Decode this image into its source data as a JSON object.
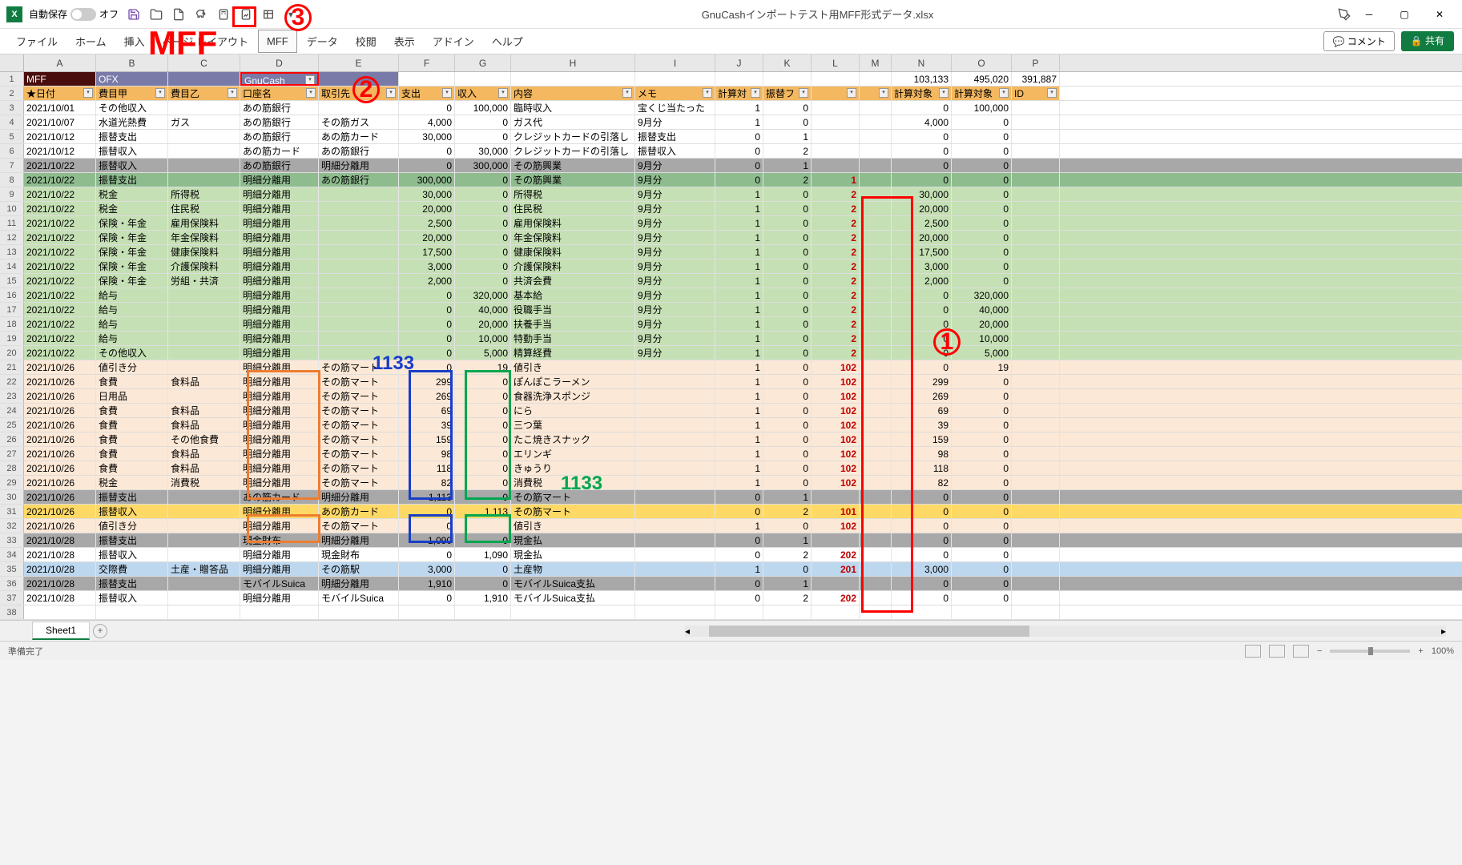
{
  "title": "GnuCashインポートテスト用MFF形式データ.xlsx",
  "autosave_label": "自動保存",
  "autosave_state": "オフ",
  "ribbon": [
    "ファイル",
    "ホーム",
    "挿入",
    "ページ レイアウト",
    "MFF",
    "データ",
    "校閲",
    "表示",
    "アドイン",
    "ヘルプ"
  ],
  "ribbon_active": "MFF",
  "comment_btn": "コメント",
  "share_btn": "共有",
  "cols": [
    "A",
    "B",
    "C",
    "D",
    "E",
    "F",
    "G",
    "H",
    "I",
    "J",
    "K",
    "L",
    "M",
    "N",
    "O",
    "P"
  ],
  "widths": [
    90,
    90,
    90,
    98,
    100,
    70,
    70,
    155,
    100,
    60,
    60,
    60,
    40,
    75,
    75,
    60
  ],
  "row1": {
    "A": "MFF",
    "B": "OFX",
    "D": "GnuCash",
    "N": "103,133",
    "O": "495,020",
    "P": "391,887"
  },
  "headers": [
    "★日付",
    "費目甲",
    "費目乙",
    "口座名",
    "取引先",
    "支出",
    "収入",
    "内容",
    "メモ",
    "計算対",
    "振替フ",
    "",
    "",
    "計算対象",
    "計算対象",
    "ID"
  ],
  "rows": [
    {
      "n": 3,
      "bg": "",
      "d": [
        "2021/10/01",
        "その他収入",
        "",
        "あの筋銀行",
        "",
        "0",
        "100,000",
        "臨時収入",
        "宝くじ当たった",
        "1",
        "0",
        "",
        "",
        "0",
        "100,000",
        ""
      ]
    },
    {
      "n": 4,
      "bg": "",
      "d": [
        "2021/10/07",
        "水道光熱費",
        "ガス",
        "あの筋銀行",
        "その筋ガス",
        "4,000",
        "0",
        "ガス代",
        "9月分",
        "1",
        "0",
        "",
        "",
        "4,000",
        "0",
        ""
      ]
    },
    {
      "n": 5,
      "bg": "",
      "d": [
        "2021/10/12",
        "振替支出",
        "",
        "あの筋銀行",
        "あの筋カード",
        "30,000",
        "0",
        "クレジットカードの引落し",
        "振替支出",
        "0",
        "1",
        "",
        "",
        "0",
        "0",
        ""
      ]
    },
    {
      "n": 6,
      "bg": "",
      "d": [
        "2021/10/12",
        "振替収入",
        "",
        "あの筋カード",
        "あの筋銀行",
        "0",
        "30,000",
        "クレジットカードの引落し",
        "振替収入",
        "0",
        "2",
        "",
        "",
        "0",
        "0",
        ""
      ]
    },
    {
      "n": 7,
      "bg": "bg-gray",
      "d": [
        "2021/10/22",
        "振替収入",
        "",
        "あの筋銀行",
        "明細分離用",
        "0",
        "300,000",
        "その筋興業",
        "9月分",
        "0",
        "1",
        "",
        "",
        "0",
        "0",
        ""
      ]
    },
    {
      "n": 8,
      "bg": "bg-dgreen",
      "d": [
        "2021/10/22",
        "振替支出",
        "",
        "明細分離用",
        "あの筋銀行",
        "300,000",
        "0",
        "その筋興業",
        "9月分",
        "0",
        "2",
        "1",
        "",
        "0",
        "0",
        ""
      ],
      "red": [
        11
      ]
    },
    {
      "n": 9,
      "bg": "bg-green",
      "d": [
        "2021/10/22",
        "税金",
        "所得税",
        "明細分離用",
        "",
        "30,000",
        "0",
        "所得税",
        "9月分",
        "1",
        "0",
        "2",
        "",
        "30,000",
        "0",
        ""
      ],
      "red": [
        11
      ]
    },
    {
      "n": 10,
      "bg": "bg-green",
      "d": [
        "2021/10/22",
        "税金",
        "住民税",
        "明細分離用",
        "",
        "20,000",
        "0",
        "住民税",
        "9月分",
        "1",
        "0",
        "2",
        "",
        "20,000",
        "0",
        ""
      ],
      "red": [
        11
      ]
    },
    {
      "n": 11,
      "bg": "bg-green",
      "d": [
        "2021/10/22",
        "保険・年金",
        "雇用保険料",
        "明細分離用",
        "",
        "2,500",
        "0",
        "雇用保険料",
        "9月分",
        "1",
        "0",
        "2",
        "",
        "2,500",
        "0",
        ""
      ],
      "red": [
        11
      ]
    },
    {
      "n": 12,
      "bg": "bg-green",
      "d": [
        "2021/10/22",
        "保険・年金",
        "年金保険料",
        "明細分離用",
        "",
        "20,000",
        "0",
        "年金保険料",
        "9月分",
        "1",
        "0",
        "2",
        "",
        "20,000",
        "0",
        ""
      ],
      "red": [
        11
      ]
    },
    {
      "n": 13,
      "bg": "bg-green",
      "d": [
        "2021/10/22",
        "保険・年金",
        "健康保険料",
        "明細分離用",
        "",
        "17,500",
        "0",
        "健康保険料",
        "9月分",
        "1",
        "0",
        "2",
        "",
        "17,500",
        "0",
        ""
      ],
      "red": [
        11
      ]
    },
    {
      "n": 14,
      "bg": "bg-green",
      "d": [
        "2021/10/22",
        "保険・年金",
        "介護保険料",
        "明細分離用",
        "",
        "3,000",
        "0",
        "介護保険料",
        "9月分",
        "1",
        "0",
        "2",
        "",
        "3,000",
        "0",
        ""
      ],
      "red": [
        11
      ]
    },
    {
      "n": 15,
      "bg": "bg-green",
      "d": [
        "2021/10/22",
        "保険・年金",
        "労組・共済",
        "明細分離用",
        "",
        "2,000",
        "0",
        "共済会費",
        "9月分",
        "1",
        "0",
        "2",
        "",
        "2,000",
        "0",
        ""
      ],
      "red": [
        11
      ]
    },
    {
      "n": 16,
      "bg": "bg-green",
      "d": [
        "2021/10/22",
        "給与",
        "",
        "明細分離用",
        "",
        "0",
        "320,000",
        "基本給",
        "9月分",
        "1",
        "0",
        "2",
        "",
        "0",
        "320,000",
        ""
      ],
      "red": [
        11
      ]
    },
    {
      "n": 17,
      "bg": "bg-green",
      "d": [
        "2021/10/22",
        "給与",
        "",
        "明細分離用",
        "",
        "0",
        "40,000",
        "役職手当",
        "9月分",
        "1",
        "0",
        "2",
        "",
        "0",
        "40,000",
        ""
      ],
      "red": [
        11
      ]
    },
    {
      "n": 18,
      "bg": "bg-green",
      "d": [
        "2021/10/22",
        "給与",
        "",
        "明細分離用",
        "",
        "0",
        "20,000",
        "扶養手当",
        "9月分",
        "1",
        "0",
        "2",
        "",
        "0",
        "20,000",
        ""
      ],
      "red": [
        11
      ]
    },
    {
      "n": 19,
      "bg": "bg-green",
      "d": [
        "2021/10/22",
        "給与",
        "",
        "明細分離用",
        "",
        "0",
        "10,000",
        "特勤手当",
        "9月分",
        "1",
        "0",
        "2",
        "",
        "0",
        "10,000",
        ""
      ],
      "red": [
        11
      ]
    },
    {
      "n": 20,
      "bg": "bg-green",
      "d": [
        "2021/10/22",
        "その他収入",
        "",
        "明細分離用",
        "",
        "0",
        "5,000",
        "精算経費",
        "9月分",
        "1",
        "0",
        "2",
        "",
        "0",
        "5,000",
        ""
      ],
      "red": [
        11
      ]
    },
    {
      "n": 21,
      "bg": "bg-cream",
      "d": [
        "2021/10/26",
        "値引き分",
        "",
        "明細分離用",
        "その筋マート",
        "0",
        "19",
        "値引き",
        "",
        "1",
        "0",
        "102",
        "",
        "0",
        "19",
        ""
      ],
      "red": [
        11
      ]
    },
    {
      "n": 22,
      "bg": "bg-cream",
      "d": [
        "2021/10/26",
        "食費",
        "食料品",
        "明細分離用",
        "その筋マート",
        "299",
        "0",
        "ぽんぽこラーメン",
        "",
        "1",
        "0",
        "102",
        "",
        "299",
        "0",
        ""
      ],
      "red": [
        11
      ]
    },
    {
      "n": 23,
      "bg": "bg-cream",
      "d": [
        "2021/10/26",
        "日用品",
        "",
        "明細分離用",
        "その筋マート",
        "269",
        "0",
        "食器洗浄スポンジ",
        "",
        "1",
        "0",
        "102",
        "",
        "269",
        "0",
        ""
      ],
      "red": [
        11
      ]
    },
    {
      "n": 24,
      "bg": "bg-cream",
      "d": [
        "2021/10/26",
        "食費",
        "食料品",
        "明細分離用",
        "その筋マート",
        "69",
        "0",
        "にら",
        "",
        "1",
        "0",
        "102",
        "",
        "69",
        "0",
        ""
      ],
      "red": [
        11
      ]
    },
    {
      "n": 25,
      "bg": "bg-cream",
      "d": [
        "2021/10/26",
        "食費",
        "食料品",
        "明細分離用",
        "その筋マート",
        "39",
        "0",
        "三つ葉",
        "",
        "1",
        "0",
        "102",
        "",
        "39",
        "0",
        ""
      ],
      "red": [
        11
      ]
    },
    {
      "n": 26,
      "bg": "bg-cream",
      "d": [
        "2021/10/26",
        "食費",
        "その他食費",
        "明細分離用",
        "その筋マート",
        "159",
        "0",
        "たこ焼きスナック",
        "",
        "1",
        "0",
        "102",
        "",
        "159",
        "0",
        ""
      ],
      "red": [
        11
      ]
    },
    {
      "n": 27,
      "bg": "bg-cream",
      "d": [
        "2021/10/26",
        "食費",
        "食料品",
        "明細分離用",
        "その筋マート",
        "98",
        "0",
        "エリンギ",
        "",
        "1",
        "0",
        "102",
        "",
        "98",
        "0",
        ""
      ],
      "red": [
        11
      ]
    },
    {
      "n": 28,
      "bg": "bg-cream",
      "d": [
        "2021/10/26",
        "食費",
        "食料品",
        "明細分離用",
        "その筋マート",
        "118",
        "0",
        "きゅうり",
        "",
        "1",
        "0",
        "102",
        "",
        "118",
        "0",
        ""
      ],
      "red": [
        11
      ]
    },
    {
      "n": 29,
      "bg": "bg-cream",
      "d": [
        "2021/10/26",
        "税金",
        "消費税",
        "明細分離用",
        "その筋マート",
        "82",
        "0",
        "消費税",
        "",
        "1",
        "0",
        "102",
        "",
        "82",
        "0",
        ""
      ],
      "red": [
        11
      ]
    },
    {
      "n": 30,
      "bg": "bg-gray",
      "d": [
        "2021/10/26",
        "振替支出",
        "",
        "あの筋カード",
        "明細分離用",
        "1,113",
        "0",
        "その筋マート",
        "",
        "0",
        "1",
        "",
        "",
        "0",
        "0",
        ""
      ]
    },
    {
      "n": 31,
      "bg": "bg-yellow",
      "d": [
        "2021/10/26",
        "振替収入",
        "",
        "明細分離用",
        "あの筋カード",
        "0",
        "1,113",
        "その筋マート",
        "",
        "0",
        "2",
        "101",
        "",
        "0",
        "0",
        ""
      ],
      "red": [
        11
      ]
    },
    {
      "n": 32,
      "bg": "bg-cream",
      "d": [
        "2021/10/26",
        "値引き分",
        "",
        "明細分離用",
        "その筋マート",
        "0",
        "",
        "値引き",
        "",
        "1",
        "0",
        "102",
        "",
        "0",
        "0",
        ""
      ],
      "red": [
        11
      ]
    },
    {
      "n": 33,
      "bg": "bg-gray",
      "d": [
        "2021/10/28",
        "振替支出",
        "",
        "現金財布",
        "明細分離用",
        "1,090",
        "0",
        "現金払",
        "",
        "0",
        "1",
        "",
        "",
        "0",
        "0",
        ""
      ]
    },
    {
      "n": 34,
      "bg": "",
      "d": [
        "2021/10/28",
        "振替収入",
        "",
        "明細分離用",
        "現金財布",
        "0",
        "1,090",
        "現金払",
        "",
        "0",
        "2",
        "202",
        "",
        "0",
        "0",
        ""
      ],
      "red": [
        11
      ]
    },
    {
      "n": 35,
      "bg": "bg-blue",
      "d": [
        "2021/10/28",
        "交際費",
        "土産・贈答品",
        "明細分離用",
        "その筋駅",
        "3,000",
        "0",
        "土産物",
        "",
        "1",
        "0",
        "201",
        "",
        "3,000",
        "0",
        ""
      ],
      "red": [
        11
      ]
    },
    {
      "n": 36,
      "bg": "bg-gray",
      "d": [
        "2021/10/28",
        "振替支出",
        "",
        "モバイルSuica",
        "明細分離用",
        "1,910",
        "0",
        "モバイルSuica支払",
        "",
        "0",
        "1",
        "",
        "",
        "0",
        "0",
        ""
      ]
    },
    {
      "n": 37,
      "bg": "",
      "d": [
        "2021/10/28",
        "振替収入",
        "",
        "明細分離用",
        "モバイルSuica",
        "0",
        "1,910",
        "モバイルSuica支払",
        "",
        "0",
        "2",
        "202",
        "",
        "0",
        "0",
        ""
      ],
      "red": [
        11
      ]
    }
  ],
  "sheet_tab": "Sheet1",
  "status": "準備完了",
  "zoom": "100%",
  "annotations": {
    "mff": "MFF",
    "n1": "①",
    "n2": "②",
    "n3": "③",
    "v1133": "1133"
  }
}
